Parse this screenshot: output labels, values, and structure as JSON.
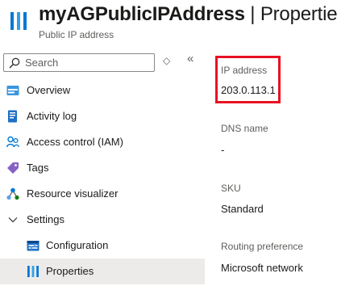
{
  "header": {
    "resource_name": "myAGPublicIPAddress",
    "separator": " | ",
    "page": "Properties",
    "subtitle": "Public IP address",
    "icon": "properties-bars-icon"
  },
  "search": {
    "placeholder": "Search",
    "icon": "search-icon"
  },
  "controls": {
    "expand_icon": "◇",
    "collapse_icon": "«"
  },
  "nav": [
    {
      "label": "Overview",
      "icon": "overview-icon"
    },
    {
      "label": "Activity log",
      "icon": "activity-log-icon"
    },
    {
      "label": "Access control (IAM)",
      "icon": "iam-people-icon"
    },
    {
      "label": "Tags",
      "icon": "tag-icon"
    },
    {
      "label": "Resource visualizer",
      "icon": "resource-visualizer-icon"
    },
    {
      "label": "Settings",
      "icon": "chevron-down-icon"
    },
    {
      "label": "Configuration",
      "icon": "configuration-icon"
    },
    {
      "label": "Properties",
      "icon": "properties-bars-icon",
      "selected": true
    }
  ],
  "properties": [
    {
      "label": "IP address",
      "value": "203.0.113.1"
    },
    {
      "label": "DNS name",
      "value": "-"
    },
    {
      "label": "SKU",
      "value": "Standard"
    },
    {
      "label": "Routing preference",
      "value": "Microsoft network"
    }
  ],
  "colors": {
    "accent": "#0078d4",
    "highlight": "#e81123",
    "selected_bg": "#edebe9"
  }
}
